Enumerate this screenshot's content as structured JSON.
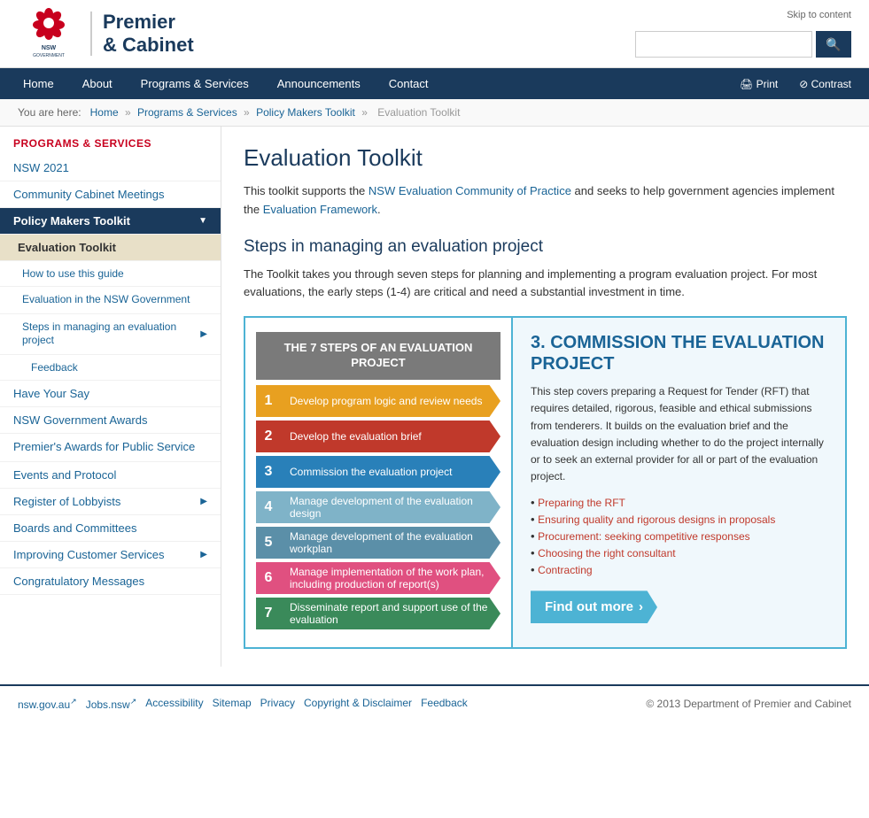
{
  "meta": {
    "skip_link": "Skip to content",
    "logo_text_line1": "Premier",
    "logo_text_line2": "& Cabinet",
    "logo_sub": "NSW GOVERNMENT"
  },
  "search": {
    "placeholder": "",
    "button_icon": "🔍"
  },
  "nav": {
    "items": [
      "Home",
      "About",
      "Programs & Services",
      "Announcements",
      "Contact"
    ],
    "utilities": [
      "Print",
      "Contrast"
    ]
  },
  "breadcrumb": {
    "items": [
      "Home",
      "Programs & Services",
      "Policy Makers Toolkit",
      "Evaluation Toolkit"
    ]
  },
  "sidebar": {
    "section_title": "PROGRAMS & SERVICES",
    "items": [
      {
        "label": "NSW 2021",
        "level": 0,
        "active": false,
        "has_arrow": false
      },
      {
        "label": "Community Cabinet Meetings",
        "level": 0,
        "active": false,
        "has_arrow": false
      },
      {
        "label": "Policy Makers Toolkit",
        "level": 0,
        "active": true,
        "is_parent": true,
        "has_arrow": true
      },
      {
        "label": "Evaluation Toolkit",
        "level": 1,
        "active": true,
        "is_child": true,
        "has_arrow": false
      },
      {
        "label": "How to use this guide",
        "level": 2,
        "active": false,
        "has_arrow": false
      },
      {
        "label": "Evaluation in the NSW Government",
        "level": 2,
        "active": false,
        "has_arrow": false
      },
      {
        "label": "Steps in managing an evaluation project",
        "level": 2,
        "active": false,
        "has_arrow": true
      },
      {
        "label": "Feedback",
        "level": 2,
        "active": false,
        "has_arrow": false
      },
      {
        "label": "Have Your Say",
        "level": 0,
        "active": false,
        "has_arrow": false
      },
      {
        "label": "NSW Government Awards",
        "level": 0,
        "active": false,
        "has_arrow": false
      },
      {
        "label": "Premier's Awards for Public Service",
        "level": 0,
        "active": false,
        "has_arrow": false
      },
      {
        "label": "Events and Protocol",
        "level": 0,
        "active": false,
        "has_arrow": false
      },
      {
        "label": "Register of Lobbyists",
        "level": 0,
        "active": false,
        "has_arrow": true
      },
      {
        "label": "Boards and Committees",
        "level": 0,
        "active": false,
        "has_arrow": false
      },
      {
        "label": "Improving Customer Services",
        "level": 0,
        "active": false,
        "has_arrow": true
      },
      {
        "label": "Congratulatory Messages",
        "level": 0,
        "active": false,
        "has_arrow": false
      }
    ]
  },
  "content": {
    "page_title": "Evaluation Toolkit",
    "intro": "This toolkit supports the NSW Evaluation Community of Practice and seeks to help government agencies implement the Evaluation Framework.",
    "intro_link1": "NSW Evaluation Community of Practice",
    "intro_link2": "Evaluation Framework",
    "section_title": "Steps in managing an evaluation project",
    "section_desc": "The Toolkit takes you through seven steps for planning and implementing a program evaluation project. For most evaluations, the early steps (1-4) are critical and need a substantial investment in time.",
    "diagram": {
      "steps_header": "THE 7 STEPS OF AN EVALUATION PROJECT",
      "steps": [
        {
          "num": "1",
          "label": "Develop program logic and review needs",
          "color": "orange"
        },
        {
          "num": "2",
          "label": "Develop the evaluation brief",
          "color": "red"
        },
        {
          "num": "3",
          "label": "Commission the evaluation project",
          "color": "blue"
        },
        {
          "num": "4",
          "label": "Manage development of the evaluation design",
          "color": "lightblue"
        },
        {
          "num": "5",
          "label": "Manage development of the evaluation workplan",
          "color": "steelblue"
        },
        {
          "num": "6",
          "label": "Manage implementation of the work plan, including production of report(s)",
          "color": "pink"
        },
        {
          "num": "7",
          "label": "Disseminate report and support use of the evaluation",
          "color": "green"
        }
      ],
      "right_panel": {
        "title": "3. COMMISSION THE EVALUATION PROJECT",
        "description": "This step covers preparing a Request for Tender (RFT) that requires detailed, rigorous, feasible and ethical submissions from tenderers. It builds on the evaluation brief and the evaluation design including whether to do the project internally or to seek an external provider for all or part of the evaluation project.",
        "links": [
          "Preparing the RFT",
          "Ensuring quality and rigorous designs in proposals",
          "Procurement: seeking competitive responses",
          "Choosing the right consultant",
          "Contracting"
        ],
        "find_out_more": "Find out more"
      }
    }
  },
  "footer": {
    "links": [
      {
        "label": "nsw.gov.au",
        "external": true
      },
      {
        "label": "Jobs.nsw",
        "external": true
      },
      {
        "label": "Accessibility",
        "external": false
      },
      {
        "label": "Sitemap",
        "external": false
      },
      {
        "label": "Privacy",
        "external": false
      },
      {
        "label": "Copyright & Disclaimer",
        "external": false
      },
      {
        "label": "Feedback",
        "external": false
      }
    ],
    "copyright": "© 2013 Department of Premier and Cabinet"
  }
}
